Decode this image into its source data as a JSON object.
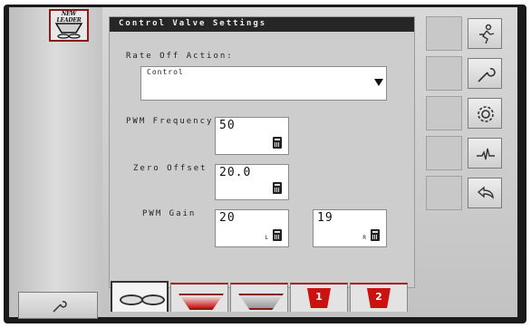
{
  "brand": {
    "logo_text": "NEW LEADER"
  },
  "panel": {
    "title": "Control Valve Settings",
    "rate_off_action": {
      "label": "Rate Off Action:",
      "value": "Control"
    },
    "pwm_frequency": {
      "label": "PWM Frequency",
      "value": "50"
    },
    "zero_offset": {
      "label": "Zero Offset",
      "value": "20.0"
    },
    "pwm_gain": {
      "label": "PWM Gain",
      "left_value": "20",
      "left_suffix": "L",
      "right_value": "19",
      "right_suffix": "R"
    }
  },
  "tabs": [
    {
      "icon": "spinner-discs-icon",
      "active": true
    },
    {
      "icon": "bin-red-icon",
      "active": false
    },
    {
      "icon": "bin-gray-icon",
      "active": false
    },
    {
      "icon": "bin-1-icon",
      "badge": "1",
      "active": false
    },
    {
      "icon": "bin-2-icon",
      "badge": "2",
      "active": false
    }
  ],
  "side_buttons": [
    "running-man-icon",
    "wrench-icon",
    "gear-icon",
    "diagnostics-icon",
    "back-icon"
  ],
  "colors": {
    "accent_red": "#b01515",
    "title_bar": "#262626"
  }
}
